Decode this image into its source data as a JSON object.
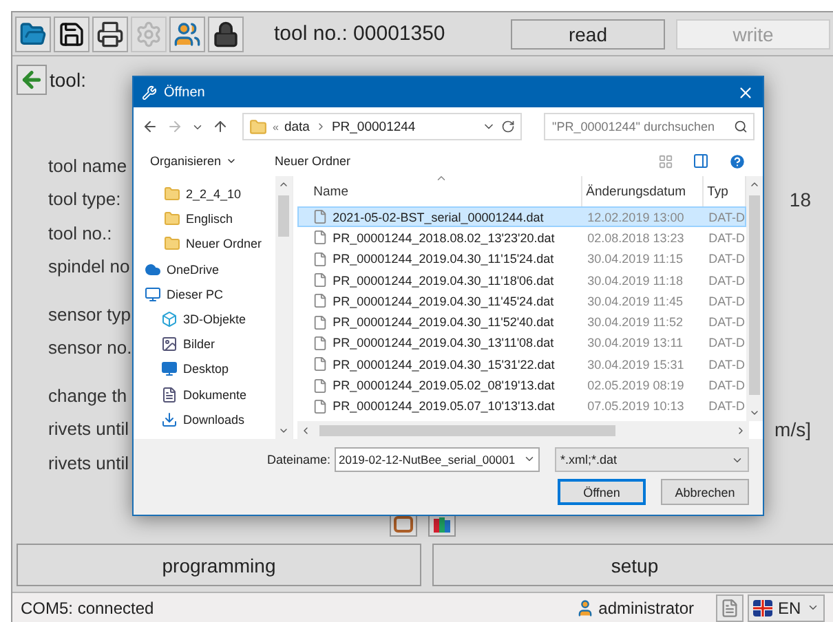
{
  "toolbar_icons": [
    {
      "kind": "folder",
      "disabled": false
    },
    {
      "kind": "save",
      "disabled": false
    },
    {
      "kind": "print",
      "disabled": false
    },
    {
      "kind": "settings",
      "disabled": true
    },
    {
      "kind": "users",
      "disabled": false
    },
    {
      "kind": "lock",
      "disabled": false
    }
  ],
  "tool_number": "tool no.: 00001350",
  "mode_buttons": [
    {
      "label": "read",
      "disabled": false
    },
    {
      "label": "write",
      "disabled": true
    }
  ],
  "tool_row": {
    "label": "tool:"
  },
  "field_groups": [
    [
      {
        "label": "tool name"
      },
      {
        "label": "tool type:",
        "value": "18"
      },
      {
        "label": "tool no.:"
      },
      {
        "label": "spindel no"
      }
    ],
    [
      {
        "label": "sensor typ"
      },
      {
        "label": "sensor no."
      }
    ],
    [
      {
        "label": "change th"
      },
      {
        "label": "rivets until",
        "value": "m/s]"
      },
      {
        "label": "rivets until"
      }
    ]
  ],
  "bottom_buttons": [
    "programming",
    "setup"
  ],
  "status_bar": {
    "connection": "COM5: connected",
    "user": "administrator",
    "language": "EN"
  },
  "dialog": {
    "title": "Öffnen",
    "path_prefix": "«",
    "path": [
      "data",
      "PR_00001244"
    ],
    "search": {
      "placeholder": "\"PR_00001244\" durchsuchen"
    },
    "commands": [
      "Organisieren",
      "Neuer Ordner"
    ],
    "nav": [
      {
        "label": "2_2_4_10",
        "kind": "folder"
      },
      {
        "label": "Englisch",
        "kind": "folder"
      },
      {
        "label": "Neuer Ordner",
        "kind": "folder"
      },
      {
        "label": "OneDrive",
        "kind": "cloud"
      },
      {
        "label": "Dieser PC",
        "kind": "pc",
        "children": [
          {
            "label": "3D-Objekte",
            "kind": "cube"
          },
          {
            "label": "Bilder",
            "kind": "pictures"
          },
          {
            "label": "Desktop",
            "kind": "desktop"
          },
          {
            "label": "Dokumente",
            "kind": "document"
          },
          {
            "label": "Downloads",
            "kind": "download"
          }
        ]
      }
    ],
    "columns": [
      "Name",
      "Änderungsdatum",
      "Typ"
    ],
    "files": [
      {
        "name": "2021-05-02-BST_serial_00001244.dat",
        "date": "12.02.2019 13:00",
        "type": "DAT-D",
        "selected": true
      },
      {
        "name": "PR_00001244_2018.08.02_13'23'20.dat",
        "date": "02.08.2018 13:23",
        "type": "DAT-D",
        "selected": false
      },
      {
        "name": "PR_00001244_2019.04.30_11'15'24.dat",
        "date": "30.04.2019 11:15",
        "type": "DAT-D",
        "selected": false
      },
      {
        "name": "PR_00001244_2019.04.30_11'18'06.dat",
        "date": "30.04.2019 11:18",
        "type": "DAT-D",
        "selected": false
      },
      {
        "name": "PR_00001244_2019.04.30_11'45'24.dat",
        "date": "30.04.2019 11:45",
        "type": "DAT-D",
        "selected": false
      },
      {
        "name": "PR_00001244_2019.04.30_11'52'40.dat",
        "date": "30.04.2019 11:52",
        "type": "DAT-D",
        "selected": false
      },
      {
        "name": "PR_00001244_2019.04.30_13'11'08.dat",
        "date": "30.04.2019 13:11",
        "type": "DAT-D",
        "selected": false
      },
      {
        "name": "PR_00001244_2019.04.30_15'31'22.dat",
        "date": "30.04.2019 15:31",
        "type": "DAT-D",
        "selected": false
      },
      {
        "name": "PR_00001244_2019.05.02_08'19'13.dat",
        "date": "02.05.2019 08:19",
        "type": "DAT-D",
        "selected": false
      },
      {
        "name": "PR_00001244_2019.05.07_10'13'13.dat",
        "date": "07.05.2019 10:13",
        "type": "DAT-D",
        "selected": false
      }
    ],
    "filename": {
      "label": "Dateiname:",
      "value": "2019-02-12-NutBee_serial_00001"
    },
    "filter": "*.xml;*.dat",
    "buttons": [
      {
        "label": "Öffnen",
        "focused": true
      },
      {
        "label": "Abbrechen",
        "focused": false
      }
    ]
  }
}
